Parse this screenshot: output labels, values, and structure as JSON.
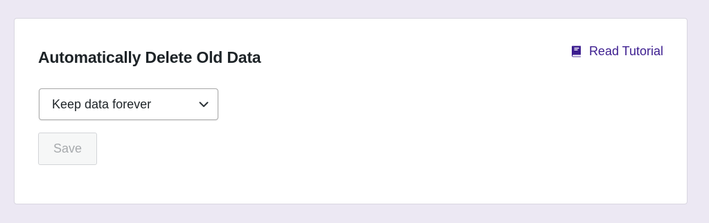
{
  "panel": {
    "title": "Automatically Delete Old Data",
    "tutorial_link": {
      "label": "Read Tutorial",
      "icon": "book-icon"
    },
    "retention_select": {
      "selected": "Keep data forever",
      "icon": "chevron-down-icon"
    },
    "save_button": {
      "label": "Save",
      "disabled": true
    }
  },
  "colors": {
    "page_background": "#ece8f3",
    "card_background": "#ffffff",
    "title_text": "#1d2327",
    "link_accent": "#3c1d8f",
    "disabled_text": "#a7aaad"
  }
}
